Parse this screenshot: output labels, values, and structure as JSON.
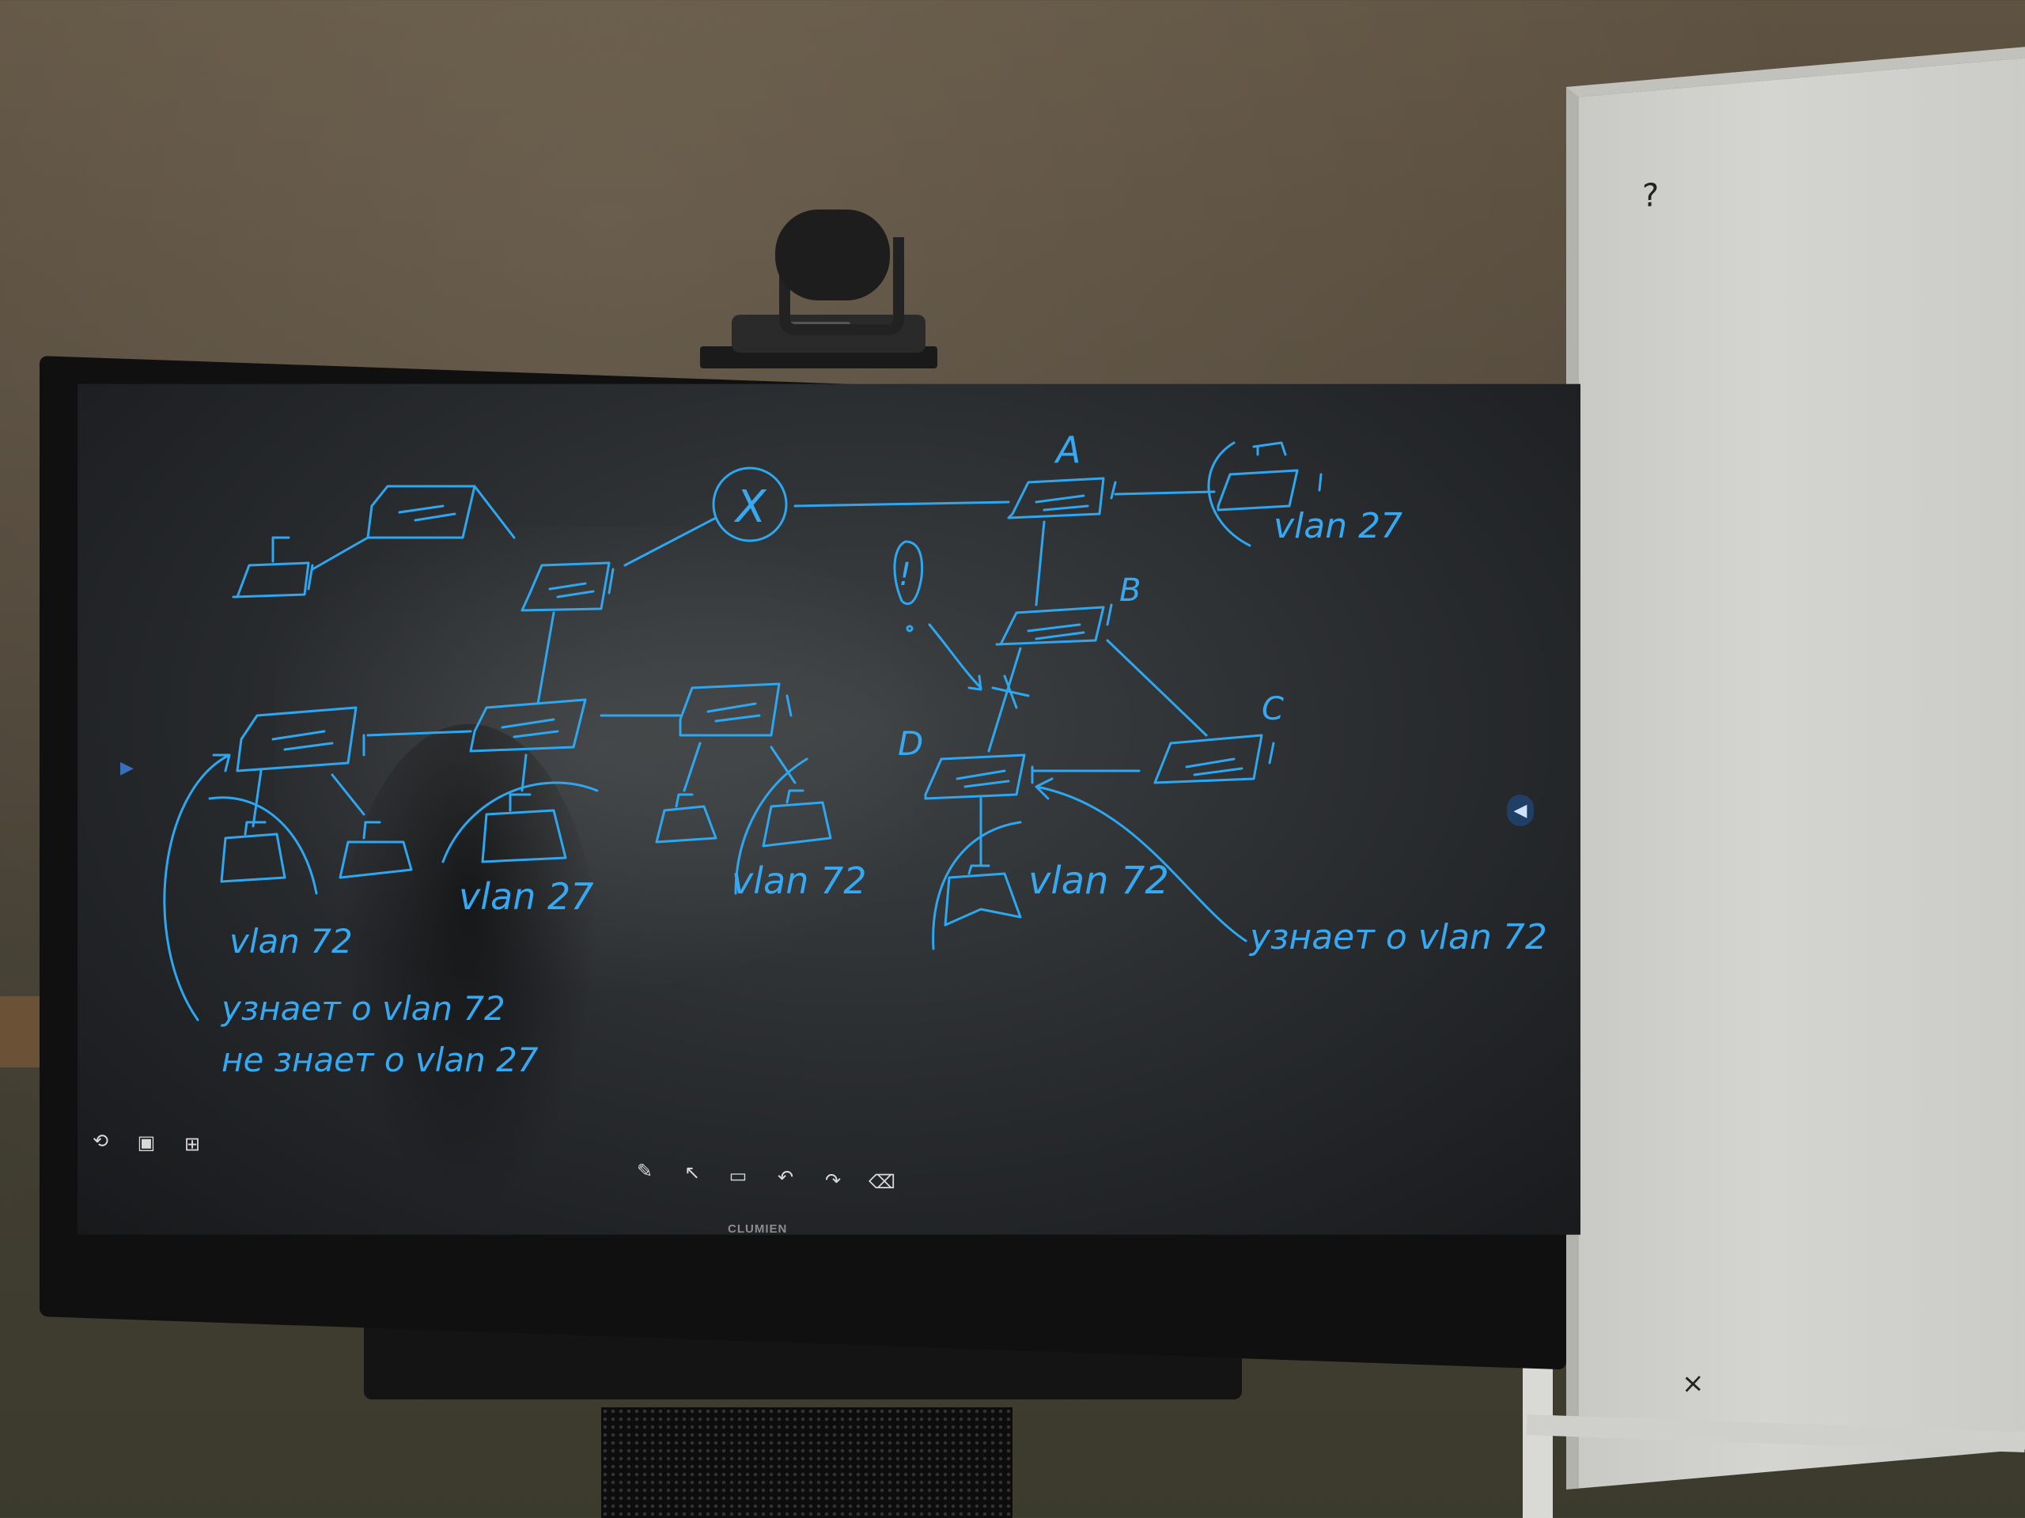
{
  "screen": {
    "node_labels": {
      "a": "A",
      "b": "B",
      "c": "C",
      "d": "D",
      "cross": "X",
      "warning": "!"
    },
    "vlan_labels": {
      "top_right": "vlan 27",
      "left_bottom": "vlan 72",
      "center_bottom": "vlan 27",
      "center_right": "vlan 72",
      "right_bottom": "vlan 72"
    },
    "notes": {
      "right": "узнает о vlan 72",
      "left_line1": "узнает о vlan 72",
      "left_line2": "не знает о vlan 27"
    },
    "left_toolbar_icons": [
      "back-icon",
      "save-icon",
      "qr-icon"
    ],
    "bottom_toolbar_icons": [
      "pen-icon",
      "select-icon",
      "whiteboard-icon",
      "undo-icon",
      "redo-icon",
      "eraser-icon"
    ],
    "brand": "CLUMIEN",
    "ink_color": "#2ea7f0"
  }
}
